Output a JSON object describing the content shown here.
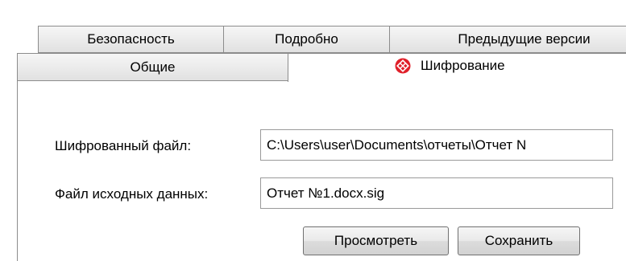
{
  "tabs": {
    "row1": [
      {
        "label": "Безопасность"
      },
      {
        "label": "Подробно"
      },
      {
        "label": "Предыдущие версии"
      }
    ],
    "row2": [
      {
        "label": "Общие"
      },
      {
        "label": "Шифрование",
        "icon": "encryption-icon",
        "active": true
      }
    ]
  },
  "encrypted_file": {
    "label": "Шифрованный файл:",
    "value": "C:\\Users\\user\\Documents\\отчеты\\Отчет N"
  },
  "source_file": {
    "label": "Файл исходных данных:",
    "value": "Отчет №1.docx.sig"
  },
  "buttons": {
    "view_label": "Просмотреть",
    "save_label": "Сохранить"
  },
  "colors": {
    "icon_red": "#e0202a",
    "border": "#8c8c8c"
  }
}
